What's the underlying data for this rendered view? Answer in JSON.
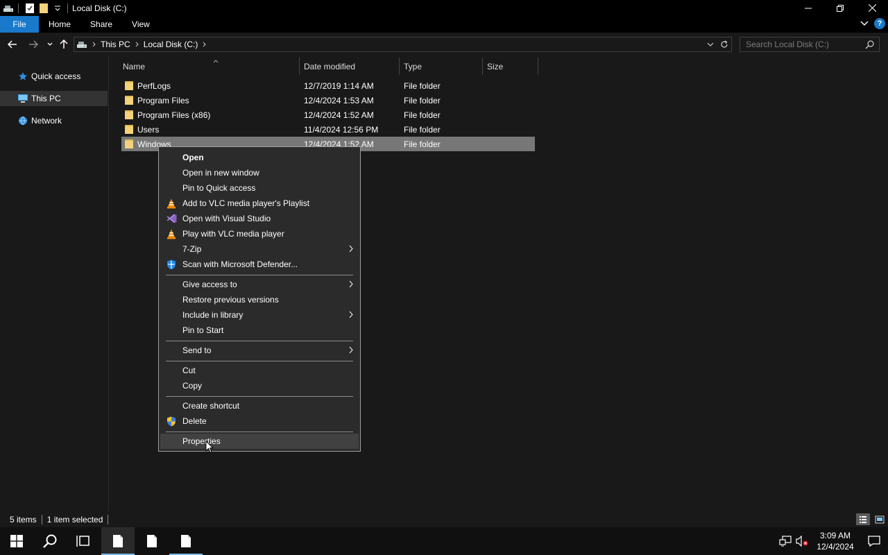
{
  "window": {
    "title": "Local Disk (C:)"
  },
  "ribbon": {
    "tabs": [
      "File",
      "Home",
      "Share",
      "View"
    ]
  },
  "address": {
    "crumbs": [
      "This PC",
      "Local Disk (C:)"
    ]
  },
  "search": {
    "placeholder": "Search Local Disk (C:)"
  },
  "nav": {
    "items": [
      "Quick access",
      "This PC",
      "Network"
    ],
    "selected": "This PC"
  },
  "columns": [
    "Name",
    "Date modified",
    "Type",
    "Size"
  ],
  "files": [
    {
      "name": "PerfLogs",
      "date": "12/7/2019 1:14 AM",
      "type": "File folder",
      "size": ""
    },
    {
      "name": "Program Files",
      "date": "12/4/2024 1:53 AM",
      "type": "File folder",
      "size": ""
    },
    {
      "name": "Program Files (x86)",
      "date": "12/4/2024 1:52 AM",
      "type": "File folder",
      "size": ""
    },
    {
      "name": "Users",
      "date": "11/4/2024 12:56 PM",
      "type": "File folder",
      "size": ""
    },
    {
      "name": "Windows",
      "date": "12/4/2024 1:52 AM",
      "type": "File folder",
      "size": "",
      "selected": true
    }
  ],
  "context_menu": {
    "items": [
      {
        "label": "Open",
        "bold": true
      },
      {
        "label": "Open in new window"
      },
      {
        "label": "Pin to Quick access"
      },
      {
        "label": "Add to VLC media player's Playlist",
        "icon": "vlc-icon"
      },
      {
        "label": "Open with Visual Studio",
        "icon": "visual-studio-icon"
      },
      {
        "label": "Play with VLC media player",
        "icon": "vlc-icon"
      },
      {
        "label": "7-Zip",
        "submenu": true
      },
      {
        "label": "Scan with Microsoft Defender...",
        "icon": "defender-shield-icon"
      },
      {
        "label": "Give access to",
        "submenu": true
      },
      {
        "label": "Restore previous versions"
      },
      {
        "label": "Include in library",
        "submenu": true
      },
      {
        "label": "Pin to Start"
      },
      {
        "label": "Send to",
        "submenu": true
      },
      {
        "label": "Cut"
      },
      {
        "label": "Copy"
      },
      {
        "label": "Create shortcut"
      },
      {
        "label": "Delete",
        "icon": "uac-shield-icon"
      },
      {
        "label": "Properties",
        "hovered": true
      }
    ]
  },
  "status": {
    "item_count": "5 items",
    "selection": "1 item selected"
  },
  "clock": {
    "time": "3:09 AM",
    "date": "12/4/2024"
  },
  "colors": {
    "accent": "#1979ca",
    "selected_row": "#777777",
    "menu_bg": "#2b2b2b",
    "folder": "#f3d27a"
  }
}
